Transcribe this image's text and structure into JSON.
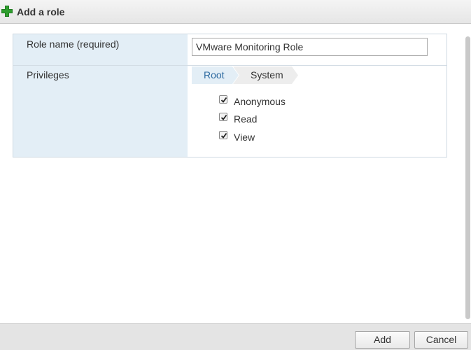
{
  "dialog": {
    "title": "Add a role",
    "icon": "plus-icon",
    "accent_color": "#2e9e2e"
  },
  "form": {
    "role_name_label": "Role name (required)",
    "role_name_value": "VMware Monitoring Role",
    "privileges_label": "Privileges"
  },
  "breadcrumb": {
    "items": [
      "Root",
      "System"
    ]
  },
  "privileges": [
    {
      "label": "Anonymous",
      "checked": true
    },
    {
      "label": "Read",
      "checked": true
    },
    {
      "label": "View",
      "checked": true
    }
  ],
  "footer": {
    "add_label": "Add",
    "cancel_label": "Cancel"
  }
}
